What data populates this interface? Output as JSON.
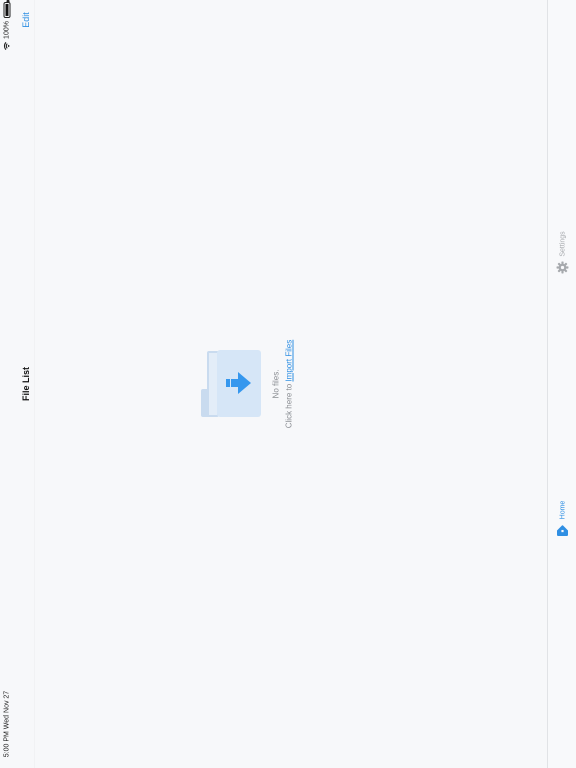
{
  "status_bar": {
    "time_date": "5:00 PM   Wed Nov 27",
    "battery": "100%",
    "battery_level": 1.0
  },
  "nav": {
    "title": "File List",
    "edit_label": "Edit"
  },
  "empty_state": {
    "message": "No files.",
    "prompt": "Click here to",
    "link_label": "Import Files"
  },
  "tab_bar": {
    "home_label": "Home",
    "settings_label": "Settings",
    "active_color": "#2f8fe3",
    "inactive_color": "#a6a9ad"
  }
}
